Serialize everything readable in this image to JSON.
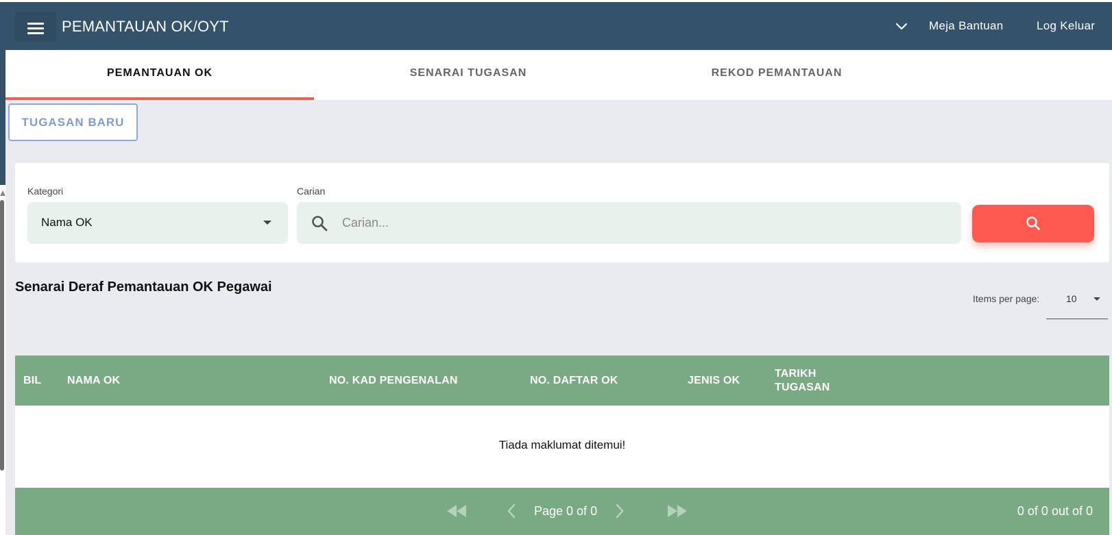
{
  "header": {
    "title": "PEMANTAUAN OK/OYT",
    "help_label": "Meja Bantuan",
    "logout_label": "Log Keluar",
    "bg_color": "#34536b"
  },
  "tabs": [
    {
      "label": "PEMANTAUAN OK",
      "active": true
    },
    {
      "label": "SENARAI TUGASAN",
      "active": false
    },
    {
      "label": "REKOD PEMANTAUAN",
      "active": false
    }
  ],
  "actions": {
    "new_task_label": "TUGASAN BARU"
  },
  "filters": {
    "category_label": "Kategori",
    "category_value": "Nama OK",
    "search_label": "Carian",
    "search_placeholder": "Carian..."
  },
  "list": {
    "title": "Senarai Deraf Pemantauan OK Pegawai",
    "items_per_page_label": "Items per page:",
    "items_per_page_value": "10",
    "columns": [
      "BIL",
      "NAMA OK",
      "NO. KAD PENGENALAN",
      "NO. DAFTAR OK",
      "JENIS OK",
      "TARIKH TUGASAN"
    ],
    "empty_message": "Tiada maklumat ditemui!",
    "page_info": "Page 0 of 0",
    "count_info": "0 of 0 out of 0"
  },
  "colors": {
    "accent": "#f15f4f",
    "search_button": "#ff5a50",
    "table_header": "#79aa84",
    "field_bg": "#e8f1ec",
    "outline_button": "#8da7e6"
  },
  "icons": [
    "menu-icon",
    "chevron-down-icon",
    "search-icon",
    "first-page-icon",
    "prev-page-icon",
    "next-page-icon",
    "last-page-icon"
  ]
}
